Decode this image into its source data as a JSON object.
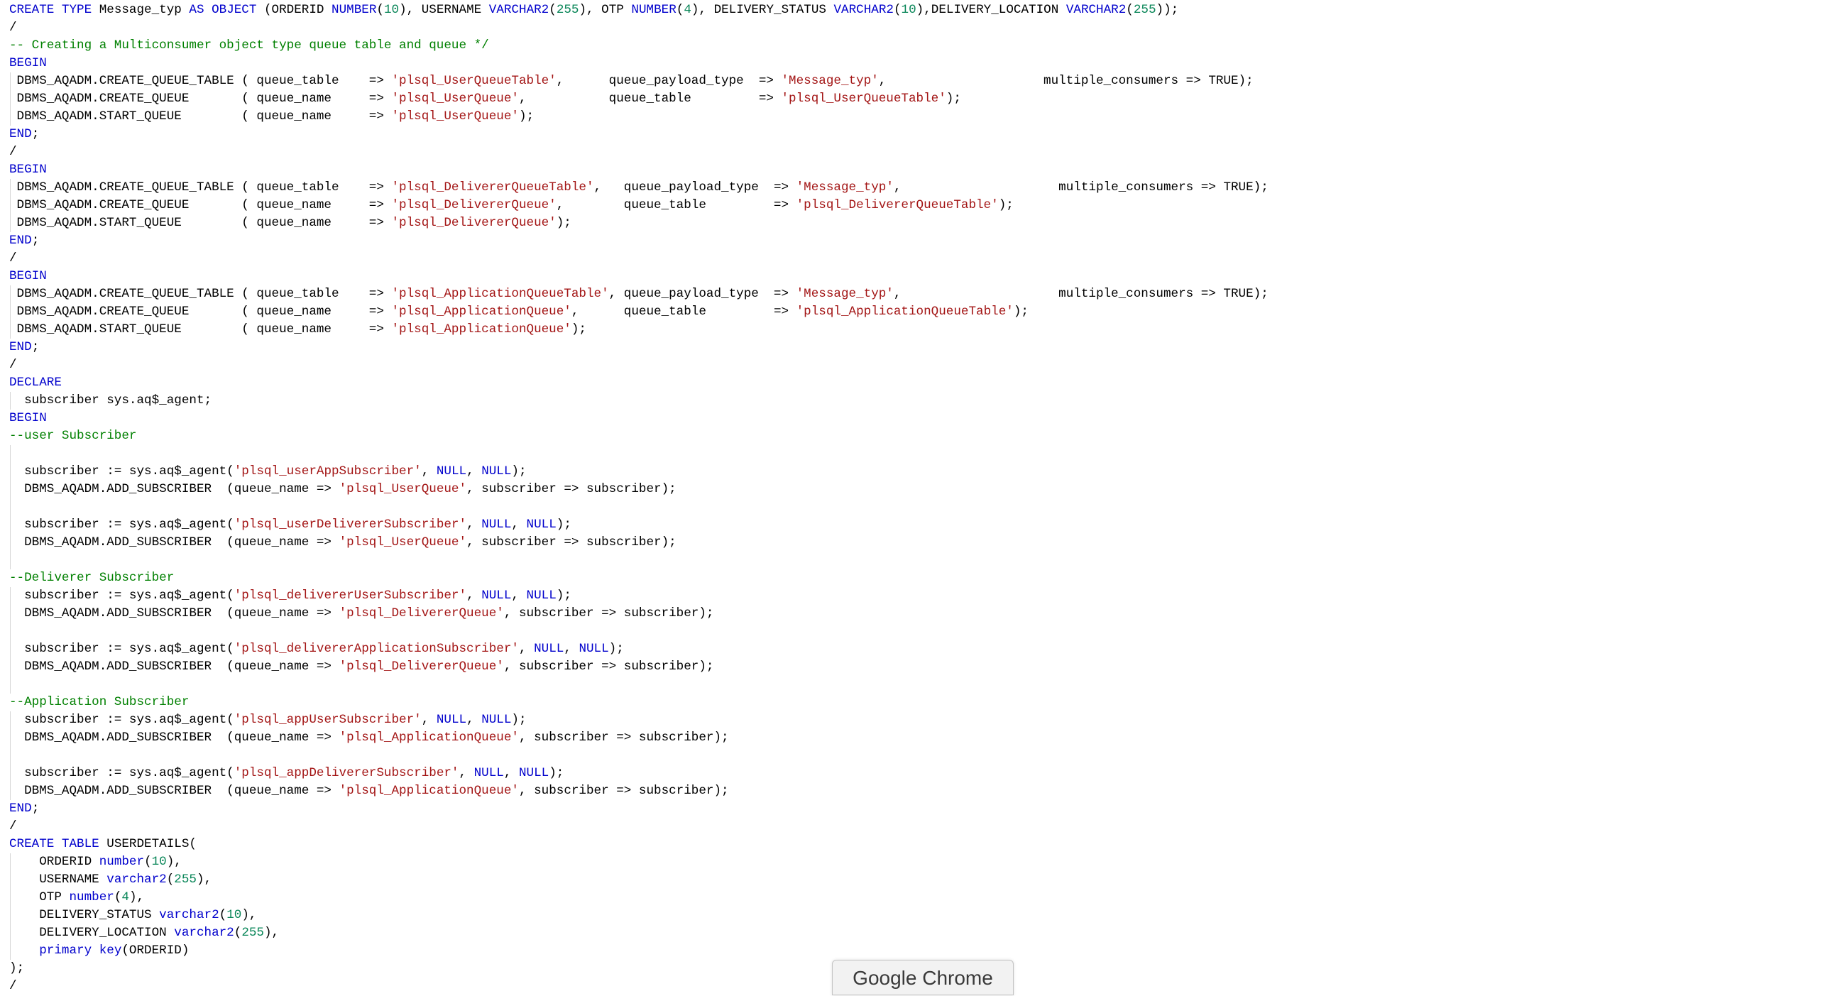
{
  "app": {
    "tooltip": "Google Chrome"
  },
  "colors": {
    "keyword": "#0000cc",
    "string": "#a31515",
    "number": "#098658",
    "comment": "#008000",
    "plain": "#000000"
  },
  "code": {
    "lines": [
      [
        [
          "kw",
          "CREATE TYPE"
        ],
        [
          "t",
          " Message_typ "
        ],
        [
          "kw",
          "AS OBJECT"
        ],
        [
          "t",
          " (ORDERID "
        ],
        [
          "kw",
          "NUMBER"
        ],
        [
          "t",
          "("
        ],
        [
          "n",
          "10"
        ],
        [
          "t",
          "), USERNAME "
        ],
        [
          "kw",
          "VARCHAR2"
        ],
        [
          "t",
          "("
        ],
        [
          "n",
          "255"
        ],
        [
          "t",
          "), OTP "
        ],
        [
          "kw",
          "NUMBER"
        ],
        [
          "t",
          "("
        ],
        [
          "n",
          "4"
        ],
        [
          "t",
          "), DELIVERY_STATUS "
        ],
        [
          "kw",
          "VARCHAR2"
        ],
        [
          "t",
          "("
        ],
        [
          "n",
          "10"
        ],
        [
          "t",
          "),DELIVERY_LOCATION "
        ],
        [
          "kw",
          "VARCHAR2"
        ],
        [
          "t",
          "("
        ],
        [
          "n",
          "255"
        ],
        [
          "t",
          "));"
        ]
      ],
      [
        [
          "t",
          "/"
        ]
      ],
      [
        [
          "c",
          "-- Creating a Multiconsumer object type queue table and queue */"
        ]
      ],
      [
        [
          "kw",
          "BEGIN"
        ]
      ],
      [
        [
          "t",
          " DBMS_AQADM.CREATE_QUEUE_TABLE ( queue_table    => "
        ],
        [
          "s",
          "'plsql_UserQueueTable'"
        ],
        [
          "t",
          ",      queue_payload_type  => "
        ],
        [
          "s",
          "'Message_typ'"
        ],
        [
          "t",
          ",                     multiple_consumers => TRUE);"
        ]
      ],
      [
        [
          "t",
          " DBMS_AQADM.CREATE_QUEUE       ( queue_name     => "
        ],
        [
          "s",
          "'plsql_UserQueue'"
        ],
        [
          "t",
          ",           queue_table         => "
        ],
        [
          "s",
          "'plsql_UserQueueTable'"
        ],
        [
          "t",
          ");"
        ]
      ],
      [
        [
          "t",
          " DBMS_AQADM.START_QUEUE        ( queue_name     => "
        ],
        [
          "s",
          "'plsql_UserQueue'"
        ],
        [
          "t",
          ");"
        ]
      ],
      [
        [
          "kw",
          "END"
        ],
        [
          "t",
          ";"
        ]
      ],
      [
        [
          "t",
          "/"
        ]
      ],
      [
        [
          "kw",
          "BEGIN"
        ]
      ],
      [
        [
          "t",
          " DBMS_AQADM.CREATE_QUEUE_TABLE ( queue_table    => "
        ],
        [
          "s",
          "'plsql_DelivererQueueTable'"
        ],
        [
          "t",
          ",   queue_payload_type  => "
        ],
        [
          "s",
          "'Message_typ'"
        ],
        [
          "t",
          ",                     multiple_consumers => TRUE);"
        ]
      ],
      [
        [
          "t",
          " DBMS_AQADM.CREATE_QUEUE       ( queue_name     => "
        ],
        [
          "s",
          "'plsql_DelivererQueue'"
        ],
        [
          "t",
          ",        queue_table         => "
        ],
        [
          "s",
          "'plsql_DelivererQueueTable'"
        ],
        [
          "t",
          ");"
        ]
      ],
      [
        [
          "t",
          " DBMS_AQADM.START_QUEUE        ( queue_name     => "
        ],
        [
          "s",
          "'plsql_DelivererQueue'"
        ],
        [
          "t",
          ");"
        ]
      ],
      [
        [
          "kw",
          "END"
        ],
        [
          "t",
          ";"
        ]
      ],
      [
        [
          "t",
          "/"
        ]
      ],
      [
        [
          "kw",
          "BEGIN"
        ]
      ],
      [
        [
          "t",
          " DBMS_AQADM.CREATE_QUEUE_TABLE ( queue_table    => "
        ],
        [
          "s",
          "'plsql_ApplicationQueueTable'"
        ],
        [
          "t",
          ", queue_payload_type  => "
        ],
        [
          "s",
          "'Message_typ'"
        ],
        [
          "t",
          ",                     multiple_consumers => TRUE);"
        ]
      ],
      [
        [
          "t",
          " DBMS_AQADM.CREATE_QUEUE       ( queue_name     => "
        ],
        [
          "s",
          "'plsql_ApplicationQueue'"
        ],
        [
          "t",
          ",      queue_table         => "
        ],
        [
          "s",
          "'plsql_ApplicationQueueTable'"
        ],
        [
          "t",
          ");"
        ]
      ],
      [
        [
          "t",
          " DBMS_AQADM.START_QUEUE        ( queue_name     => "
        ],
        [
          "s",
          "'plsql_ApplicationQueue'"
        ],
        [
          "t",
          ");"
        ]
      ],
      [
        [
          "kw",
          "END"
        ],
        [
          "t",
          ";"
        ]
      ],
      [
        [
          "t",
          "/"
        ]
      ],
      [
        [
          "kw",
          "DECLARE"
        ]
      ],
      [
        [
          "t",
          "  subscriber sys.aq$_agent;"
        ]
      ],
      [
        [
          "kw",
          "BEGIN"
        ]
      ],
      [
        [
          "c",
          "--user Subscriber"
        ]
      ],
      [
        [
          "t",
          ""
        ]
      ],
      [
        [
          "t",
          "  subscriber := sys.aq$_agent("
        ],
        [
          "s",
          "'plsql_userAppSubscriber'"
        ],
        [
          "t",
          ", "
        ],
        [
          "kw",
          "NULL"
        ],
        [
          "t",
          ", "
        ],
        [
          "kw",
          "NULL"
        ],
        [
          "t",
          ");"
        ]
      ],
      [
        [
          "t",
          "  DBMS_AQADM.ADD_SUBSCRIBER  (queue_name => "
        ],
        [
          "s",
          "'plsql_UserQueue'"
        ],
        [
          "t",
          ", subscriber => subscriber);"
        ]
      ],
      [
        [
          "t",
          ""
        ]
      ],
      [
        [
          "t",
          "  subscriber := sys.aq$_agent("
        ],
        [
          "s",
          "'plsql_userDelivererSubscriber'"
        ],
        [
          "t",
          ", "
        ],
        [
          "kw",
          "NULL"
        ],
        [
          "t",
          ", "
        ],
        [
          "kw",
          "NULL"
        ],
        [
          "t",
          ");"
        ]
      ],
      [
        [
          "t",
          "  DBMS_AQADM.ADD_SUBSCRIBER  (queue_name => "
        ],
        [
          "s",
          "'plsql_UserQueue'"
        ],
        [
          "t",
          ", subscriber => subscriber);"
        ]
      ],
      [
        [
          "t",
          ""
        ]
      ],
      [
        [
          "c",
          "--Deliverer Subscriber"
        ]
      ],
      [
        [
          "t",
          "  subscriber := sys.aq$_agent("
        ],
        [
          "s",
          "'plsql_delivererUserSubscriber'"
        ],
        [
          "t",
          ", "
        ],
        [
          "kw",
          "NULL"
        ],
        [
          "t",
          ", "
        ],
        [
          "kw",
          "NULL"
        ],
        [
          "t",
          ");"
        ]
      ],
      [
        [
          "t",
          "  DBMS_AQADM.ADD_SUBSCRIBER  (queue_name => "
        ],
        [
          "s",
          "'plsql_DelivererQueue'"
        ],
        [
          "t",
          ", subscriber => subscriber);"
        ]
      ],
      [
        [
          "t",
          ""
        ]
      ],
      [
        [
          "t",
          "  subscriber := sys.aq$_agent("
        ],
        [
          "s",
          "'plsql_delivererApplicationSubscriber'"
        ],
        [
          "t",
          ", "
        ],
        [
          "kw",
          "NULL"
        ],
        [
          "t",
          ", "
        ],
        [
          "kw",
          "NULL"
        ],
        [
          "t",
          ");"
        ]
      ],
      [
        [
          "t",
          "  DBMS_AQADM.ADD_SUBSCRIBER  (queue_name => "
        ],
        [
          "s",
          "'plsql_DelivererQueue'"
        ],
        [
          "t",
          ", subscriber => subscriber);"
        ]
      ],
      [
        [
          "t",
          ""
        ]
      ],
      [
        [
          "c",
          "--Application Subscriber"
        ]
      ],
      [
        [
          "t",
          "  subscriber := sys.aq$_agent("
        ],
        [
          "s",
          "'plsql_appUserSubscriber'"
        ],
        [
          "t",
          ", "
        ],
        [
          "kw",
          "NULL"
        ],
        [
          "t",
          ", "
        ],
        [
          "kw",
          "NULL"
        ],
        [
          "t",
          ");"
        ]
      ],
      [
        [
          "t",
          "  DBMS_AQADM.ADD_SUBSCRIBER  (queue_name => "
        ],
        [
          "s",
          "'plsql_ApplicationQueue'"
        ],
        [
          "t",
          ", subscriber => subscriber);"
        ]
      ],
      [
        [
          "t",
          ""
        ]
      ],
      [
        [
          "t",
          "  subscriber := sys.aq$_agent("
        ],
        [
          "s",
          "'plsql_appDelivererSubscriber'"
        ],
        [
          "t",
          ", "
        ],
        [
          "kw",
          "NULL"
        ],
        [
          "t",
          ", "
        ],
        [
          "kw",
          "NULL"
        ],
        [
          "t",
          ");"
        ]
      ],
      [
        [
          "t",
          "  DBMS_AQADM.ADD_SUBSCRIBER  (queue_name => "
        ],
        [
          "s",
          "'plsql_ApplicationQueue'"
        ],
        [
          "t",
          ", subscriber => subscriber);"
        ]
      ],
      [
        [
          "kw",
          "END"
        ],
        [
          "t",
          ";"
        ]
      ],
      [
        [
          "t",
          "/"
        ]
      ],
      [
        [
          "kw",
          "CREATE TABLE"
        ],
        [
          "t",
          " USERDETAILS("
        ]
      ],
      [
        [
          "t",
          "    ORDERID "
        ],
        [
          "kw",
          "number"
        ],
        [
          "t",
          "("
        ],
        [
          "n",
          "10"
        ],
        [
          "t",
          "),"
        ]
      ],
      [
        [
          "t",
          "    USERNAME "
        ],
        [
          "kw",
          "varchar2"
        ],
        [
          "t",
          "("
        ],
        [
          "n",
          "255"
        ],
        [
          "t",
          "),"
        ]
      ],
      [
        [
          "t",
          "    OTP "
        ],
        [
          "kw",
          "number"
        ],
        [
          "t",
          "("
        ],
        [
          "n",
          "4"
        ],
        [
          "t",
          "),"
        ]
      ],
      [
        [
          "t",
          "    DELIVERY_STATUS "
        ],
        [
          "kw",
          "varchar2"
        ],
        [
          "t",
          "("
        ],
        [
          "n",
          "10"
        ],
        [
          "t",
          "),"
        ]
      ],
      [
        [
          "t",
          "    DELIVERY_LOCATION "
        ],
        [
          "kw",
          "varchar2"
        ],
        [
          "t",
          "("
        ],
        [
          "n",
          "255"
        ],
        [
          "t",
          "),"
        ]
      ],
      [
        [
          "t",
          "    "
        ],
        [
          "kw",
          "primary key"
        ],
        [
          "t",
          "(ORDERID)"
        ]
      ],
      [
        [
          "t",
          ");"
        ]
      ],
      [
        [
          "t",
          "/"
        ]
      ]
    ]
  }
}
